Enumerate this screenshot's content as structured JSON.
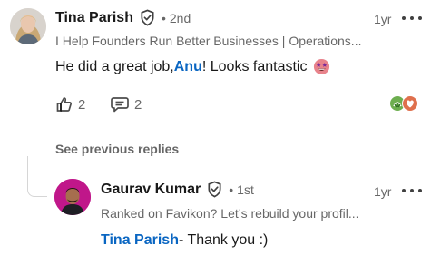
{
  "comment": {
    "author": "Tina Parish",
    "degree": "2nd",
    "time": "1yr",
    "headline": "I Help Founders Run Better Businesses | Operations...",
    "text_before": "He did a great job, ",
    "mention": "Anu",
    "text_after": "! Looks fantastic",
    "emoji": "star-struck-emoji",
    "likes": "2",
    "replies": "2",
    "reaction_icons": [
      "support-icon",
      "love-icon"
    ]
  },
  "see_previous": "See previous replies",
  "reply": {
    "author": "Gaurav Kumar",
    "degree": "1st",
    "time": "1yr",
    "headline": "Ranked on Favikon? Let’s rebuild your profil...",
    "mention": "Tina Parish",
    "text": " - Thank you :)"
  },
  "colors": {
    "link": "#0a66c2",
    "secondary_text": "rgba(0,0,0,0.6)",
    "support_reaction": "#6dae4f",
    "love_reaction": "#df704d",
    "avatar2_bg": "#c0178a"
  }
}
